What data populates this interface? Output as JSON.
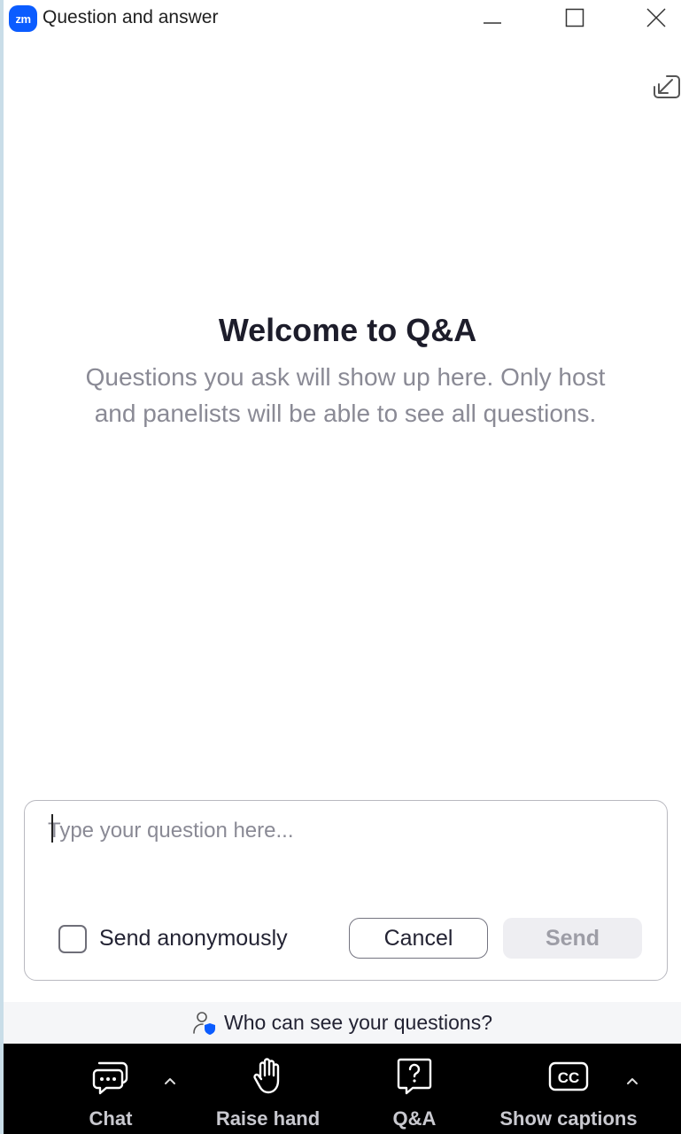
{
  "window": {
    "app_logo": "zm",
    "title": "Question and answer",
    "controls": [
      "minimize-icon",
      "maximize-icon",
      "close-icon"
    ]
  },
  "panel": {
    "popin_icon": "pop-in-arrow-icon"
  },
  "empty_state": {
    "title": "Welcome to Q&A",
    "description": "Questions you ask will show up here. Only host and panelists will be able to see all questions."
  },
  "compose": {
    "placeholder": "Type your question here...",
    "value": "",
    "anonymous_label": "Send anonymously",
    "anonymous_checked": false,
    "cancel_label": "Cancel",
    "send_label": "Send",
    "send_enabled": false
  },
  "visibility": {
    "link_text": "Who can see your questions?"
  },
  "toolbar": {
    "chat_label": "Chat",
    "raise_hand_label": "Raise hand",
    "qa_label": "Q&A",
    "captions_label": "Show captions"
  },
  "colors": {
    "brand": "#0b5cff",
    "toolbar_bg": "#000000",
    "toolbar_text": "#c9c9cf",
    "muted_text": "#8a8a95",
    "disabled_button": "#eeeef2"
  }
}
